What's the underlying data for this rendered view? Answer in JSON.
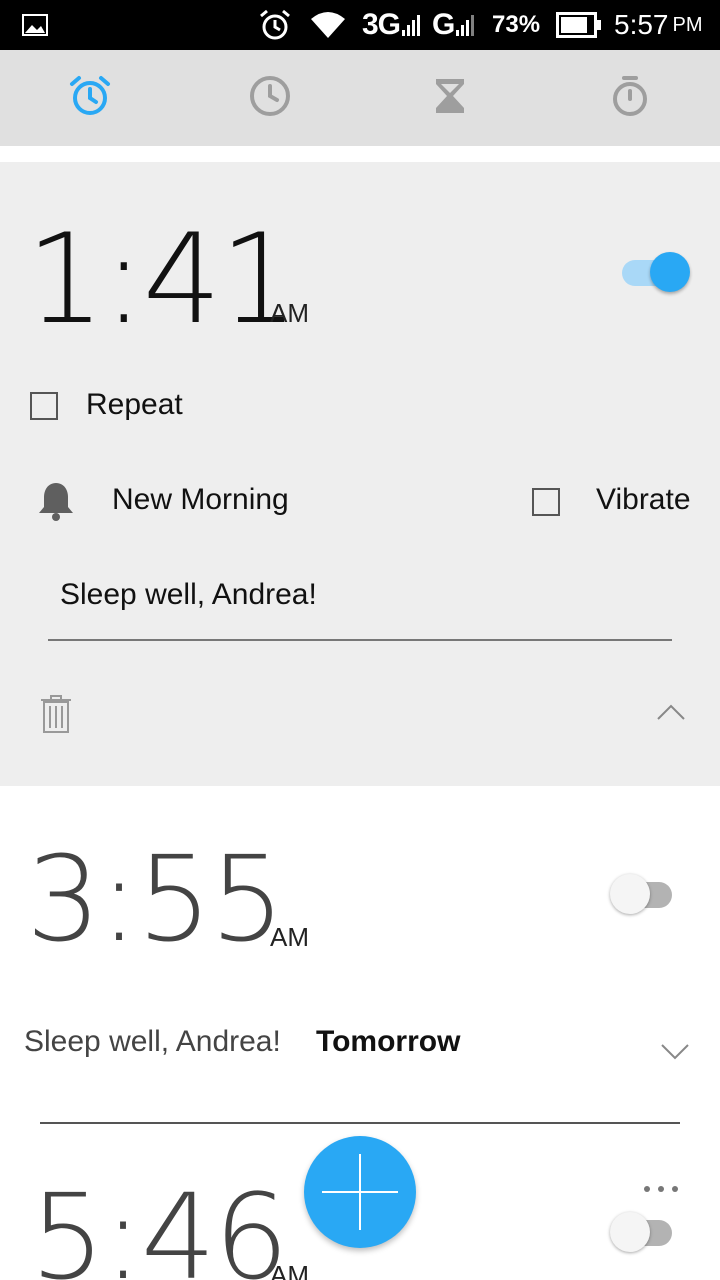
{
  "status_bar": {
    "network1": "3G",
    "network2": "G",
    "battery_pct": "73%",
    "time": "5:57",
    "time_suffix": "PM",
    "icons": [
      "gallery-icon",
      "alarm-icon",
      "wifi-icon",
      "signal-icon",
      "battery-icon"
    ]
  },
  "tabs": [
    {
      "name": "alarm",
      "icon": "alarm-clock-icon",
      "active": true
    },
    {
      "name": "clock",
      "icon": "clock-icon",
      "active": false
    },
    {
      "name": "timer",
      "icon": "hourglass-icon",
      "active": false
    },
    {
      "name": "stopwatch",
      "icon": "stopwatch-icon",
      "active": false
    }
  ],
  "alarms": [
    {
      "time": "1:41",
      "ampm": "AM",
      "enabled": true,
      "repeat_label": "Repeat",
      "ringtone": "New Morning",
      "vibrate_label": "Vibrate",
      "label_value": "Sleep well, Andrea!"
    },
    {
      "time": "3:55",
      "ampm": "AM",
      "enabled": false,
      "label": "Sleep well, Andrea!",
      "day": "Tomorrow"
    },
    {
      "time": "5:46",
      "ampm": "AM",
      "enabled": false
    }
  ],
  "colors": {
    "accent": "#29a8f4",
    "tab_inactive": "#9e9e9e"
  }
}
